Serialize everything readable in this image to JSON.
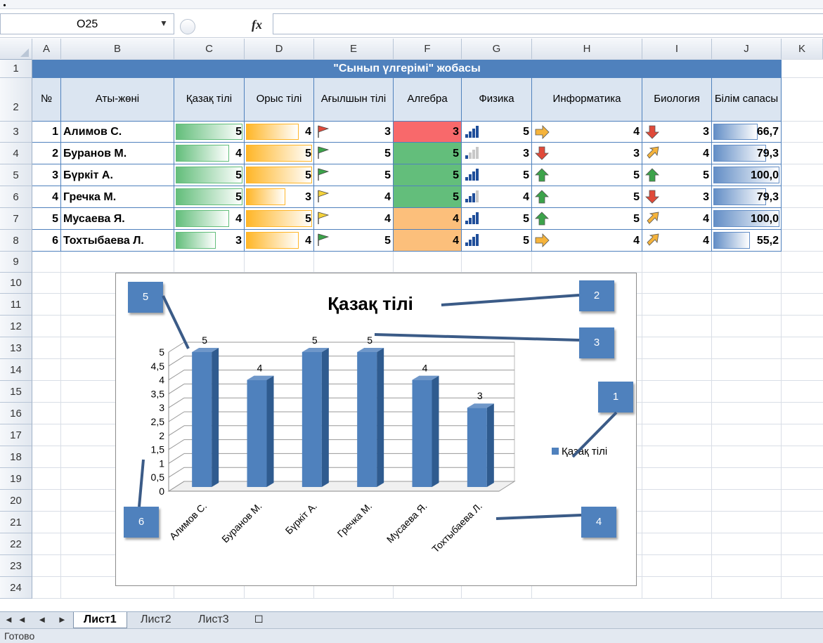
{
  "name_box": {
    "value": "O25"
  },
  "formula": {
    "fx": "fx",
    "value": ""
  },
  "columns": [
    "A",
    "B",
    "C",
    "D",
    "E",
    "F",
    "G",
    "H",
    "I",
    "J",
    "K"
  ],
  "rows": [
    "1",
    "2",
    "3",
    "4",
    "5",
    "6",
    "7",
    "8",
    "9",
    "10",
    "11",
    "12",
    "13",
    "14",
    "15",
    "16",
    "17",
    "18",
    "19",
    "20",
    "21",
    "22",
    "23",
    "24"
  ],
  "table": {
    "title": "\"Сынып үлгерімі\" жобасы",
    "headers": [
      "№",
      "Аты-жөні",
      "Қазақ тілі",
      "Орыс тілі",
      "Ағылшын тілі",
      "Алгебра",
      "Физика",
      "Информатика",
      "Биология",
      "Білім сапасы"
    ],
    "students": [
      {
        "n": "1",
        "name": "Алимов С.",
        "kaz": "5",
        "rus": "4",
        "eng": "3",
        "alg": "3",
        "phys": "5",
        "inf": "4",
        "bio": "3",
        "quality": "66,7"
      },
      {
        "n": "2",
        "name": "Буранов М.",
        "kaz": "4",
        "rus": "5",
        "eng": "5",
        "alg": "5",
        "phys": "3",
        "inf": "3",
        "bio": "4",
        "quality": "79,3"
      },
      {
        "n": "3",
        "name": "Бүркіт А.",
        "kaz": "5",
        "rus": "5",
        "eng": "5",
        "alg": "5",
        "phys": "5",
        "inf": "5",
        "bio": "5",
        "quality": "100,0"
      },
      {
        "n": "4",
        "name": "Гречка М.",
        "kaz": "5",
        "rus": "3",
        "eng": "4",
        "alg": "5",
        "phys": "4",
        "inf": "5",
        "bio": "3",
        "quality": "79,3"
      },
      {
        "n": "5",
        "name": "Мусаева Я.",
        "kaz": "4",
        "rus": "5",
        "eng": "4",
        "alg": "4",
        "phys": "5",
        "inf": "5",
        "bio": "4",
        "quality": "100,0"
      },
      {
        "n": "6",
        "name": "Тохтыбаева Л.",
        "kaz": "3",
        "rus": "4",
        "eng": "5",
        "alg": "4",
        "phys": "5",
        "inf": "4",
        "bio": "4",
        "quality": "55,2"
      }
    ],
    "quality_fraction": [
      0.667,
      0.793,
      1.0,
      0.793,
      1.0,
      0.552
    ],
    "colors": {
      "header_bg": "#4f81bd",
      "subheader_bg": "#dbe5f1",
      "red": "#f8696b",
      "green": "#63be7b",
      "orange": "#fcbf7b",
      "bar_green": "#63be7b",
      "bar_orange": "#ffb628",
      "bar_blue": "#638ec6"
    },
    "icons": {
      "flag": [
        "red-flag-icon",
        "green-flag-icon",
        "green-flag-icon",
        "yellow-flag-icon",
        "yellow-flag-icon",
        "green-flag-icon"
      ],
      "signal": [
        "signal-4-icon",
        "signal-1-icon",
        "signal-4-icon",
        "signal-3-icon",
        "signal-4-icon",
        "signal-4-icon"
      ],
      "inf_arrow": [
        "right-arrow-icon",
        "down-arrow-icon",
        "up-arrow-icon",
        "up-arrow-icon",
        "up-arrow-icon",
        "right-arrow-icon"
      ],
      "bio_arrow": [
        "down-arrow-icon",
        "up-right-arrow-icon",
        "up-arrow-icon",
        "down-arrow-icon",
        "up-right-arrow-icon",
        "up-right-arrow-icon"
      ]
    }
  },
  "chart_data": {
    "type": "bar",
    "title": "Қазақ тілі",
    "categories": [
      "Алимов С.",
      "Буранов М.",
      "Бүркіт А.",
      "Гречка М.",
      "Мусаева Я.",
      "Тохтыбаева Л."
    ],
    "series": [
      {
        "name": "Қазақ тілі",
        "values": [
          5,
          4,
          5,
          5,
          4,
          3
        ]
      }
    ],
    "data_labels": [
      "5",
      "4",
      "5",
      "5",
      "4",
      "3"
    ],
    "ylim": [
      0,
      5
    ],
    "yticks": [
      "0",
      "0,5",
      "1",
      "1,5",
      "2",
      "2,5",
      "3",
      "3,5",
      "4",
      "4,5",
      "5"
    ],
    "grid": true,
    "legend": "right",
    "bar_color": "#4f81bd",
    "callouts": [
      "1",
      "2",
      "3",
      "4",
      "5",
      "6"
    ]
  },
  "sheets": {
    "nav": "◄◄ ◄ ► ►►",
    "tabs": [
      "Лист1",
      "Лист2",
      "Лист3"
    ],
    "active": "Лист1"
  },
  "status": {
    "text": "Готово"
  }
}
